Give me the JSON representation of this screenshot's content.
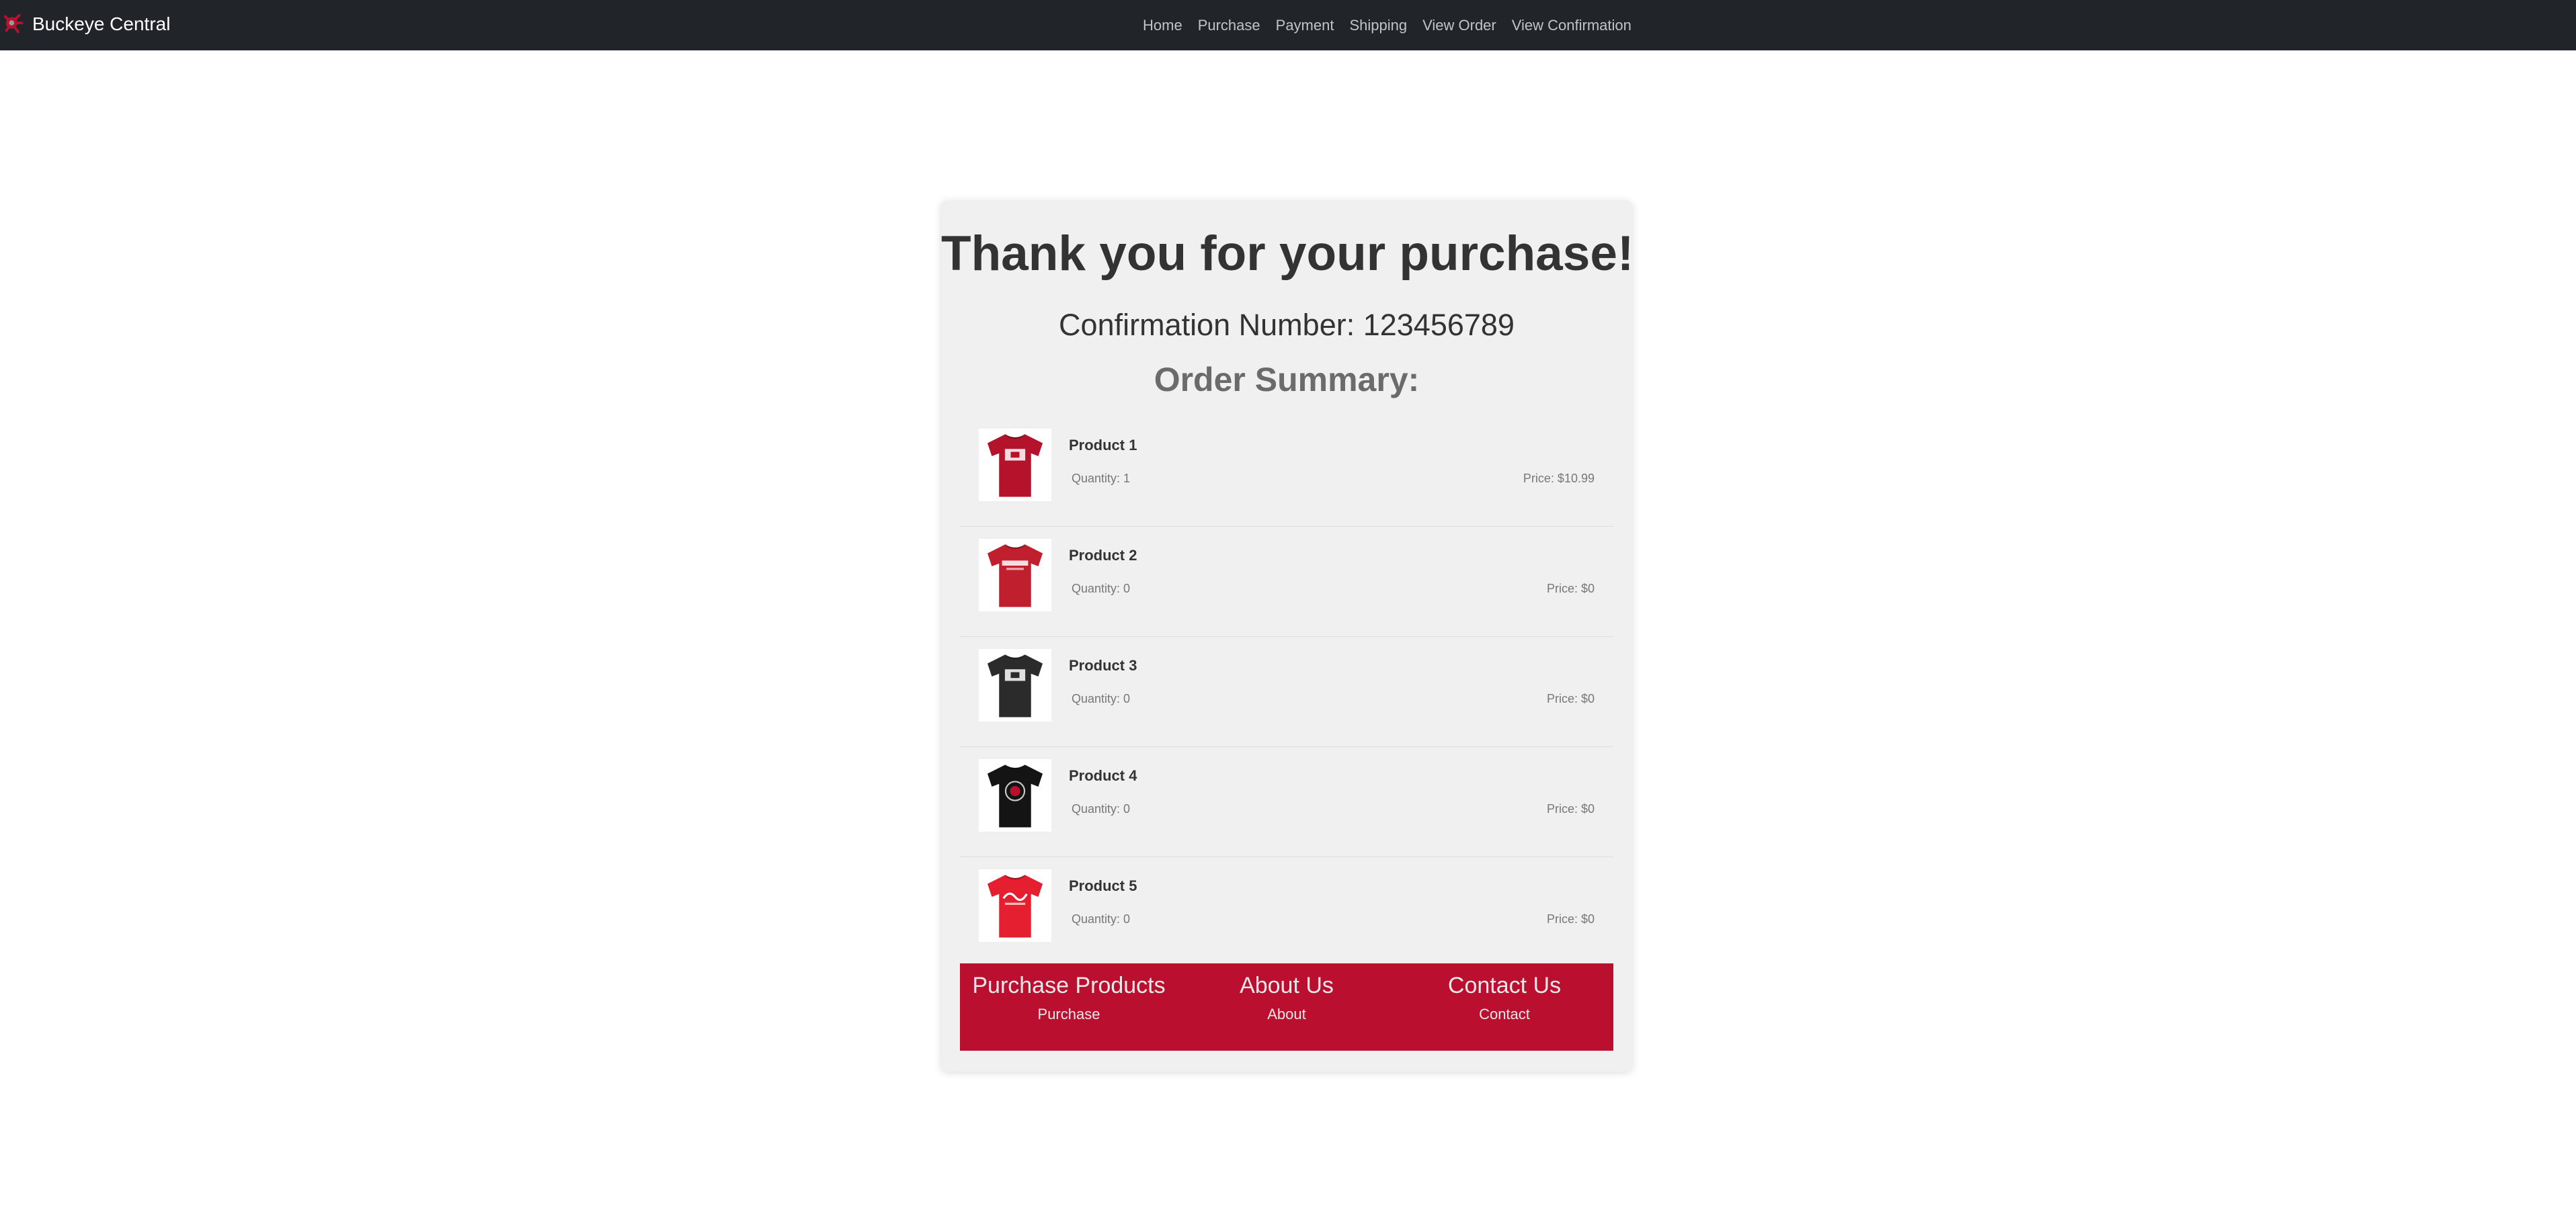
{
  "brand": {
    "name": "Buckeye Central",
    "logo_icon": "buckeye-leaf-icon"
  },
  "nav": {
    "links": [
      "Home",
      "Purchase",
      "Payment",
      "Shipping",
      "View Order",
      "View Confirmation"
    ]
  },
  "confirmation": {
    "title": "Thank you for your purchase!",
    "confirmation_label": "Confirmation Number: 123456789",
    "summary_heading": "Order Summary:"
  },
  "products": [
    {
      "name": "Product 1",
      "quantity": "Quantity: 1",
      "price": "Price: $10.99",
      "shirt_color": "#b5122c",
      "print": "block-o"
    },
    {
      "name": "Product 2",
      "quantity": "Quantity: 0",
      "price": "Price: $0",
      "shirt_color": "#c01f2e",
      "print": "wordmark"
    },
    {
      "name": "Product 3",
      "quantity": "Quantity: 0",
      "price": "Price: $0",
      "shirt_color": "#2b2b2b",
      "print": "block-o"
    },
    {
      "name": "Product 4",
      "quantity": "Quantity: 0",
      "price": "Price: $0",
      "shirt_color": "#141414",
      "print": "circle"
    },
    {
      "name": "Product 5",
      "quantity": "Quantity: 0",
      "price": "Price: $0",
      "shirt_color": "#e51f2f",
      "print": "script"
    }
  ],
  "footer": {
    "columns": [
      {
        "heading": "Purchase Products",
        "link": "Purchase"
      },
      {
        "heading": "About Us",
        "link": "About"
      },
      {
        "heading": "Contact Us",
        "link": "Contact"
      }
    ]
  },
  "colors": {
    "navbar": "#212529",
    "footer": "#bb0f30",
    "card": "#f0f0f0"
  }
}
